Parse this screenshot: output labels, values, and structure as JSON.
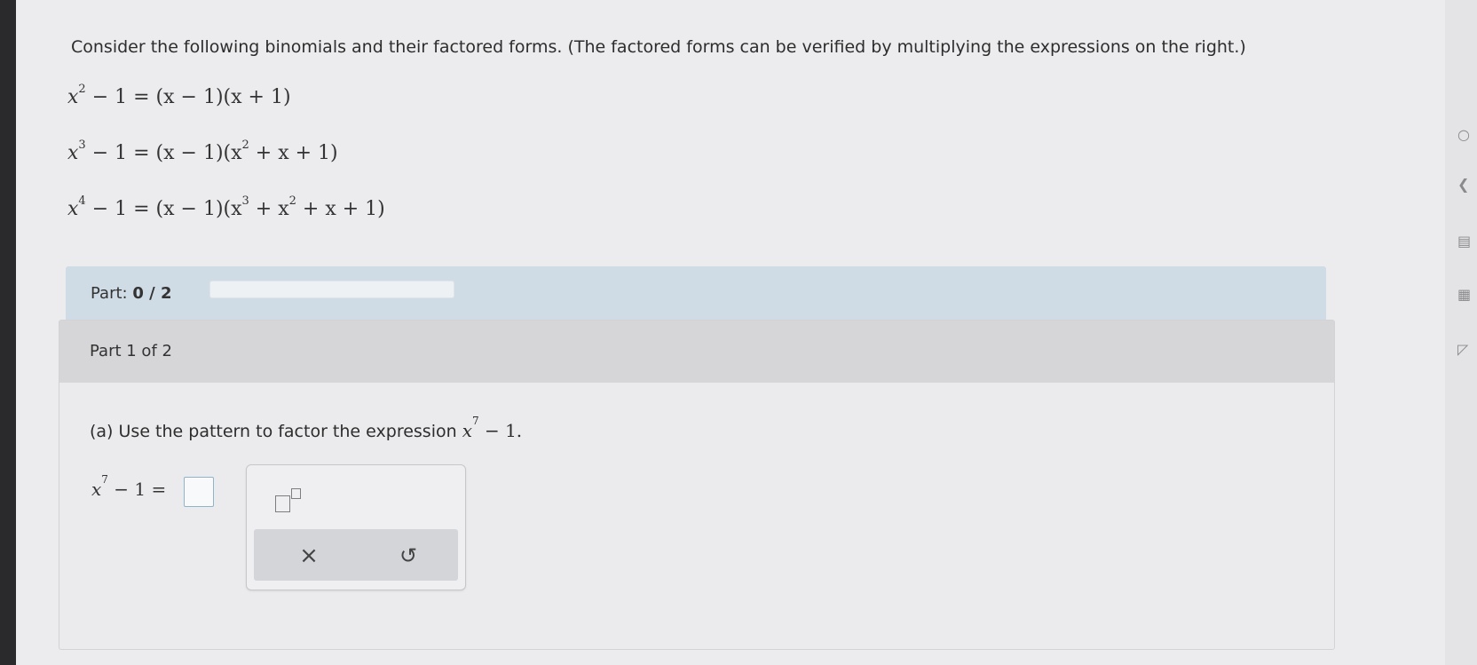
{
  "problem": {
    "intro": "Consider the following binomials and their factored forms. (The factored forms can be verified by multiplying the expressions on the right.)",
    "equations": [
      {
        "lhs_exp": "2",
        "lhs_rest": " − 1 = (x − 1)(x + 1)"
      },
      {
        "lhs_exp": "3",
        "lhs_rest_a": " − 1 = (x − 1)(x",
        "inner_exp": "2",
        "lhs_rest_b": " + x + 1)"
      },
      {
        "lhs_exp": "4",
        "lhs_rest_a": " − 1 = (x − 1)(x",
        "inner_exp1": "3",
        "mid": " + x",
        "inner_exp2": "2",
        "lhs_rest_b": " + x + 1)"
      }
    ]
  },
  "progress": {
    "label": "Part:",
    "value": "0 / 2",
    "fraction": 0.0
  },
  "part": {
    "header": "Part 1 of 2",
    "question_prefix": "(a) Use the pattern to factor the expression ",
    "question_base": "x",
    "question_exp": "7",
    "question_suffix": " − 1.",
    "answer_base": "x",
    "answer_exp": "7",
    "answer_rest": " − 1 ="
  },
  "keypad": {
    "superscript_icon": "superscript-template-icon",
    "clear_label": "×",
    "undo_label": "↺"
  },
  "rail": {
    "icons": [
      "○",
      "❮",
      "▤",
      "▦",
      "◸"
    ]
  }
}
